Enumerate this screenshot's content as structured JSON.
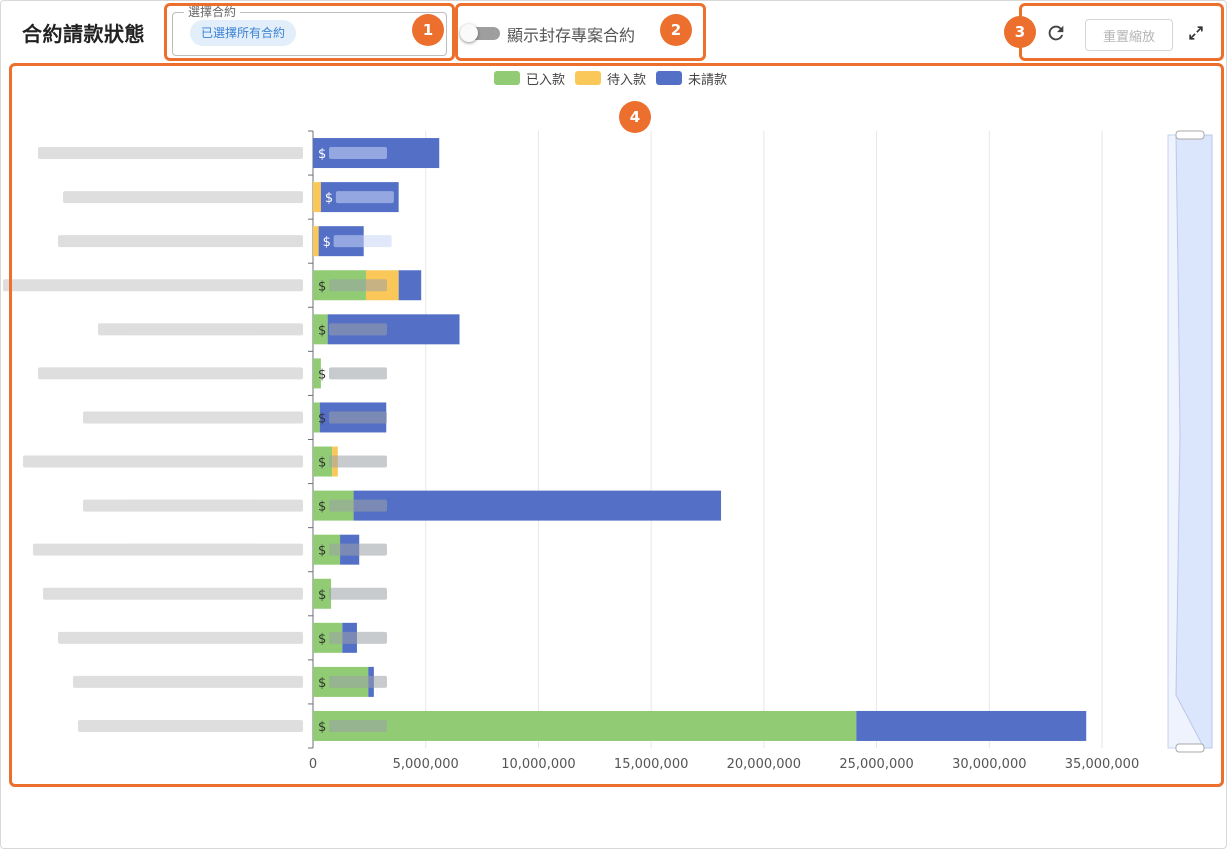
{
  "header": {
    "title": "合約請款狀態",
    "contract_select_label": "選擇合約",
    "contract_select_value": "已選擇所有合約",
    "archive_toggle_label": "顯示封存專案合約",
    "archive_toggle_on": false,
    "reset_zoom_label": "重置縮放",
    "refresh_icon": "refresh-icon",
    "fullscreen_icon": "fullscreen-icon"
  },
  "callouts": [
    "1",
    "2",
    "3",
    "4"
  ],
  "colors": {
    "received": "#91cc75",
    "pending": "#fac858",
    "unbilled": "#5470c6",
    "callout": "#ec6f2d"
  },
  "chart_data": {
    "type": "bar",
    "orientation": "horizontal",
    "stacked": true,
    "legend_position": "top-center",
    "grid": true,
    "xlim": [
      0,
      35000000
    ],
    "x_ticks": [
      "0",
      "5,000,000",
      "10,000,000",
      "15,000,000",
      "20,000,000",
      "25,000,000",
      "30,000,000",
      "35,000,000"
    ],
    "categories": [
      "",
      "",
      "",
      "",
      "",
      "",
      "",
      "",
      "",
      "",
      "",
      "",
      "",
      ""
    ],
    "series": [
      {
        "name": "已入款",
        "values": [
          0,
          0,
          0,
          2350000,
          650000,
          350000,
          300000,
          850000,
          1800000,
          1200000,
          800000,
          1300000,
          2450000,
          24100000
        ]
      },
      {
        "name": "待入款",
        "values": [
          0,
          350000,
          250000,
          1450000,
          0,
          0,
          0,
          250000,
          0,
          0,
          0,
          0,
          0,
          0
        ]
      },
      {
        "name": "未請款",
        "values": [
          5600000,
          3450000,
          2000000,
          1000000,
          5850000,
          0,
          2950000,
          0,
          16300000,
          850000,
          0,
          650000,
          250000,
          10200000
        ]
      }
    ],
    "zoom_slider": true
  }
}
